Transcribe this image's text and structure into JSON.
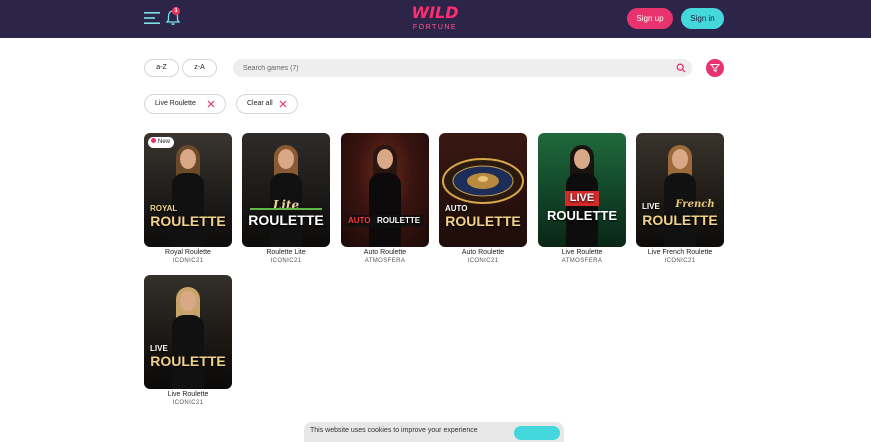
{
  "header": {
    "notification_count": "1",
    "logo_main": "WILD",
    "logo_sub": "FORTUNE",
    "signup_label": "Sign up",
    "signin_label": "Sign in"
  },
  "toolbar": {
    "sort_az": "a-Z",
    "sort_za": "z-A",
    "search_placeholder": "Search games (7)"
  },
  "filters": {
    "chips": [
      {
        "label": "Live Roulette"
      },
      {
        "label": "Clear all"
      }
    ]
  },
  "games": [
    {
      "title": "Royal Roulette",
      "provider": "ICONIC21",
      "badge": "New",
      "art_top": "ROYAL",
      "art_main": "ROULETTE"
    },
    {
      "title": "Roulette Lite",
      "provider": "ICONIC21",
      "art_top": "Lite",
      "art_main": "ROULETTE"
    },
    {
      "title": "Auto Roulette",
      "provider": "ATMOSFERA",
      "art_top": "AUTO",
      "art_main": "ROULETTE"
    },
    {
      "title": "Auto Roulette",
      "provider": "ICONIC21",
      "art_top": "AUTO",
      "art_main": "ROULETTE"
    },
    {
      "title": "Live Roulette",
      "provider": "ATMOSFERA",
      "art_top": "LIVE",
      "art_main": "ROULETTE"
    },
    {
      "title": "Live French Roulette",
      "provider": "ICONIC21",
      "art_top": "LIVE",
      "art_extra": "French",
      "art_main": "ROULETTE"
    },
    {
      "title": "Live Roulette",
      "provider": "ICONIC21",
      "art_top": "LIVE",
      "art_main": "ROULETTE"
    }
  ],
  "cookie_banner": {
    "text": "This website uses cookies to improve your experience"
  },
  "colors": {
    "header_bg": "#2c2449",
    "brand_pink": "#e8336e",
    "brand_cyan": "#44d8dd"
  }
}
